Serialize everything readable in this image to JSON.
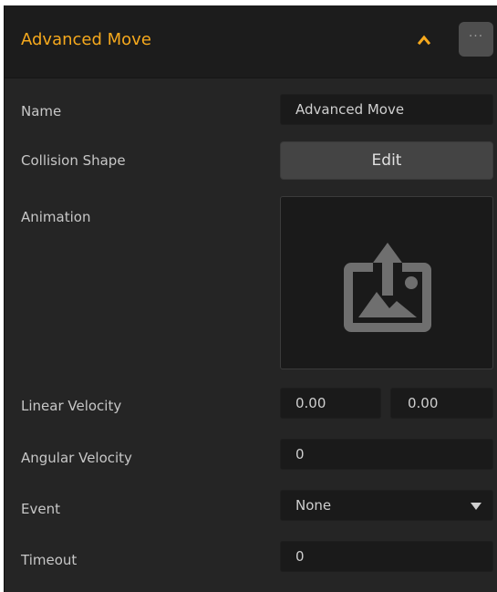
{
  "header": {
    "title": "Advanced Move",
    "collapse_icon": "chevron-up-icon",
    "more_icon": "more-horizontal-icon",
    "more_label": "···",
    "accent_color": "#f6a91d"
  },
  "fields": {
    "name": {
      "label": "Name",
      "value": "Advanced Move"
    },
    "collision_shape": {
      "label": "Collision Shape",
      "button_label": "Edit"
    },
    "animation": {
      "label": "Animation",
      "icon": "image-upload-icon"
    },
    "linear_velocity": {
      "label": "Linear Velocity",
      "x": "0.00",
      "y": "0.00"
    },
    "angular_velocity": {
      "label": "Angular Velocity",
      "value": "0"
    },
    "event": {
      "label": "Event",
      "value": "None"
    },
    "timeout": {
      "label": "Timeout",
      "value": "0"
    }
  }
}
